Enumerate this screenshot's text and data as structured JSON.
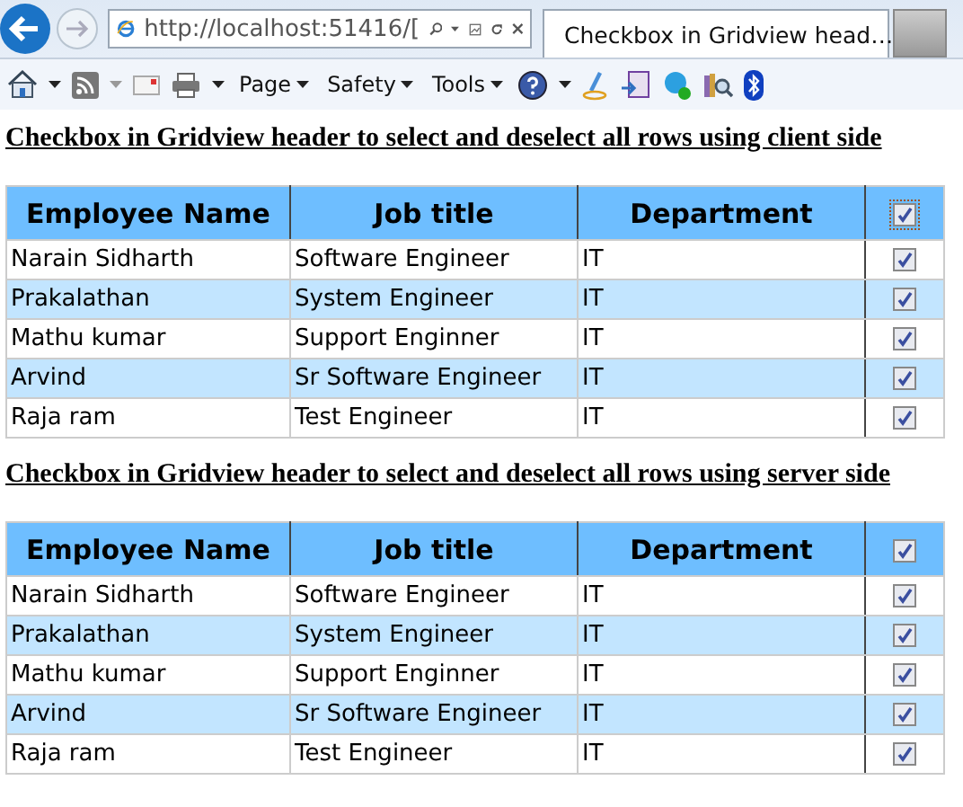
{
  "browser": {
    "address": "http://localhost:51416/[",
    "tab_title": "Checkbox in Gridview head…"
  },
  "toolbar": {
    "menus": [
      "Page",
      "Safety",
      "Tools"
    ]
  },
  "sections": [
    {
      "heading": "Checkbox in Gridview header to select and deselect all rows using client side",
      "columns": [
        "Employee Name",
        "Job title",
        "Department"
      ],
      "header_checked": true,
      "header_focused": true,
      "rows": [
        {
          "name": "Narain Sidharth",
          "job": "Software Engineer",
          "dept": "IT",
          "checked": true
        },
        {
          "name": "Prakalathan",
          "job": "System Engineer",
          "dept": "IT",
          "checked": true
        },
        {
          "name": "Mathu kumar",
          "job": "Support Enginner",
          "dept": "IT",
          "checked": true
        },
        {
          "name": "Arvind",
          "job": "Sr Software Engineer",
          "dept": "IT",
          "checked": true
        },
        {
          "name": "Raja ram",
          "job": "Test Engineer",
          "dept": "IT",
          "checked": true
        }
      ]
    },
    {
      "heading": "Checkbox in Gridview header to select and deselect all rows using server side",
      "columns": [
        "Employee Name",
        "Job title",
        "Department"
      ],
      "header_checked": true,
      "header_focused": false,
      "rows": [
        {
          "name": "Narain Sidharth",
          "job": "Software Engineer",
          "dept": "IT",
          "checked": true
        },
        {
          "name": "Prakalathan",
          "job": "System Engineer",
          "dept": "IT",
          "checked": true
        },
        {
          "name": "Mathu kumar",
          "job": "Support Enginner",
          "dept": "IT",
          "checked": true
        },
        {
          "name": "Arvind",
          "job": "Sr Software Engineer",
          "dept": "IT",
          "checked": true
        },
        {
          "name": "Raja ram",
          "job": "Test Engineer",
          "dept": "IT",
          "checked": true
        }
      ]
    }
  ]
}
